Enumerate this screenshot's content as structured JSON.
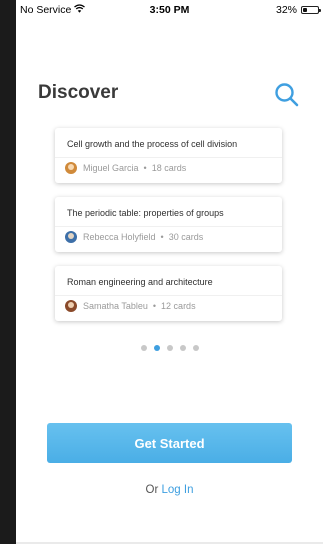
{
  "status_bar": {
    "carrier": "No Service",
    "time": "3:50 PM",
    "battery": "32%",
    "battery_level": 0.32
  },
  "header": {
    "title": "Discover",
    "search_icon": "search-icon"
  },
  "cards": [
    {
      "title": "Cell growth and the process of cell division",
      "author": "Miguel Garcia",
      "count": "18 cards",
      "avatar_color": "#d08a3a"
    },
    {
      "title": "The periodic table: properties of groups",
      "author": "Rebecca Holyfield",
      "count": "30 cards",
      "avatar_color": "#3d6fa8"
    },
    {
      "title": "Roman engineering and architecture",
      "author": "Samatha Tableu",
      "count": "12 cards",
      "avatar_color": "#8a4a2a"
    }
  ],
  "pagination": {
    "total": 5,
    "active_index": 1
  },
  "cta": {
    "label": "Get Started"
  },
  "login": {
    "prefix": "Or",
    "link_label": "Log In"
  },
  "colors": {
    "accent": "#3f9fe0",
    "button": "#59b6ea"
  }
}
